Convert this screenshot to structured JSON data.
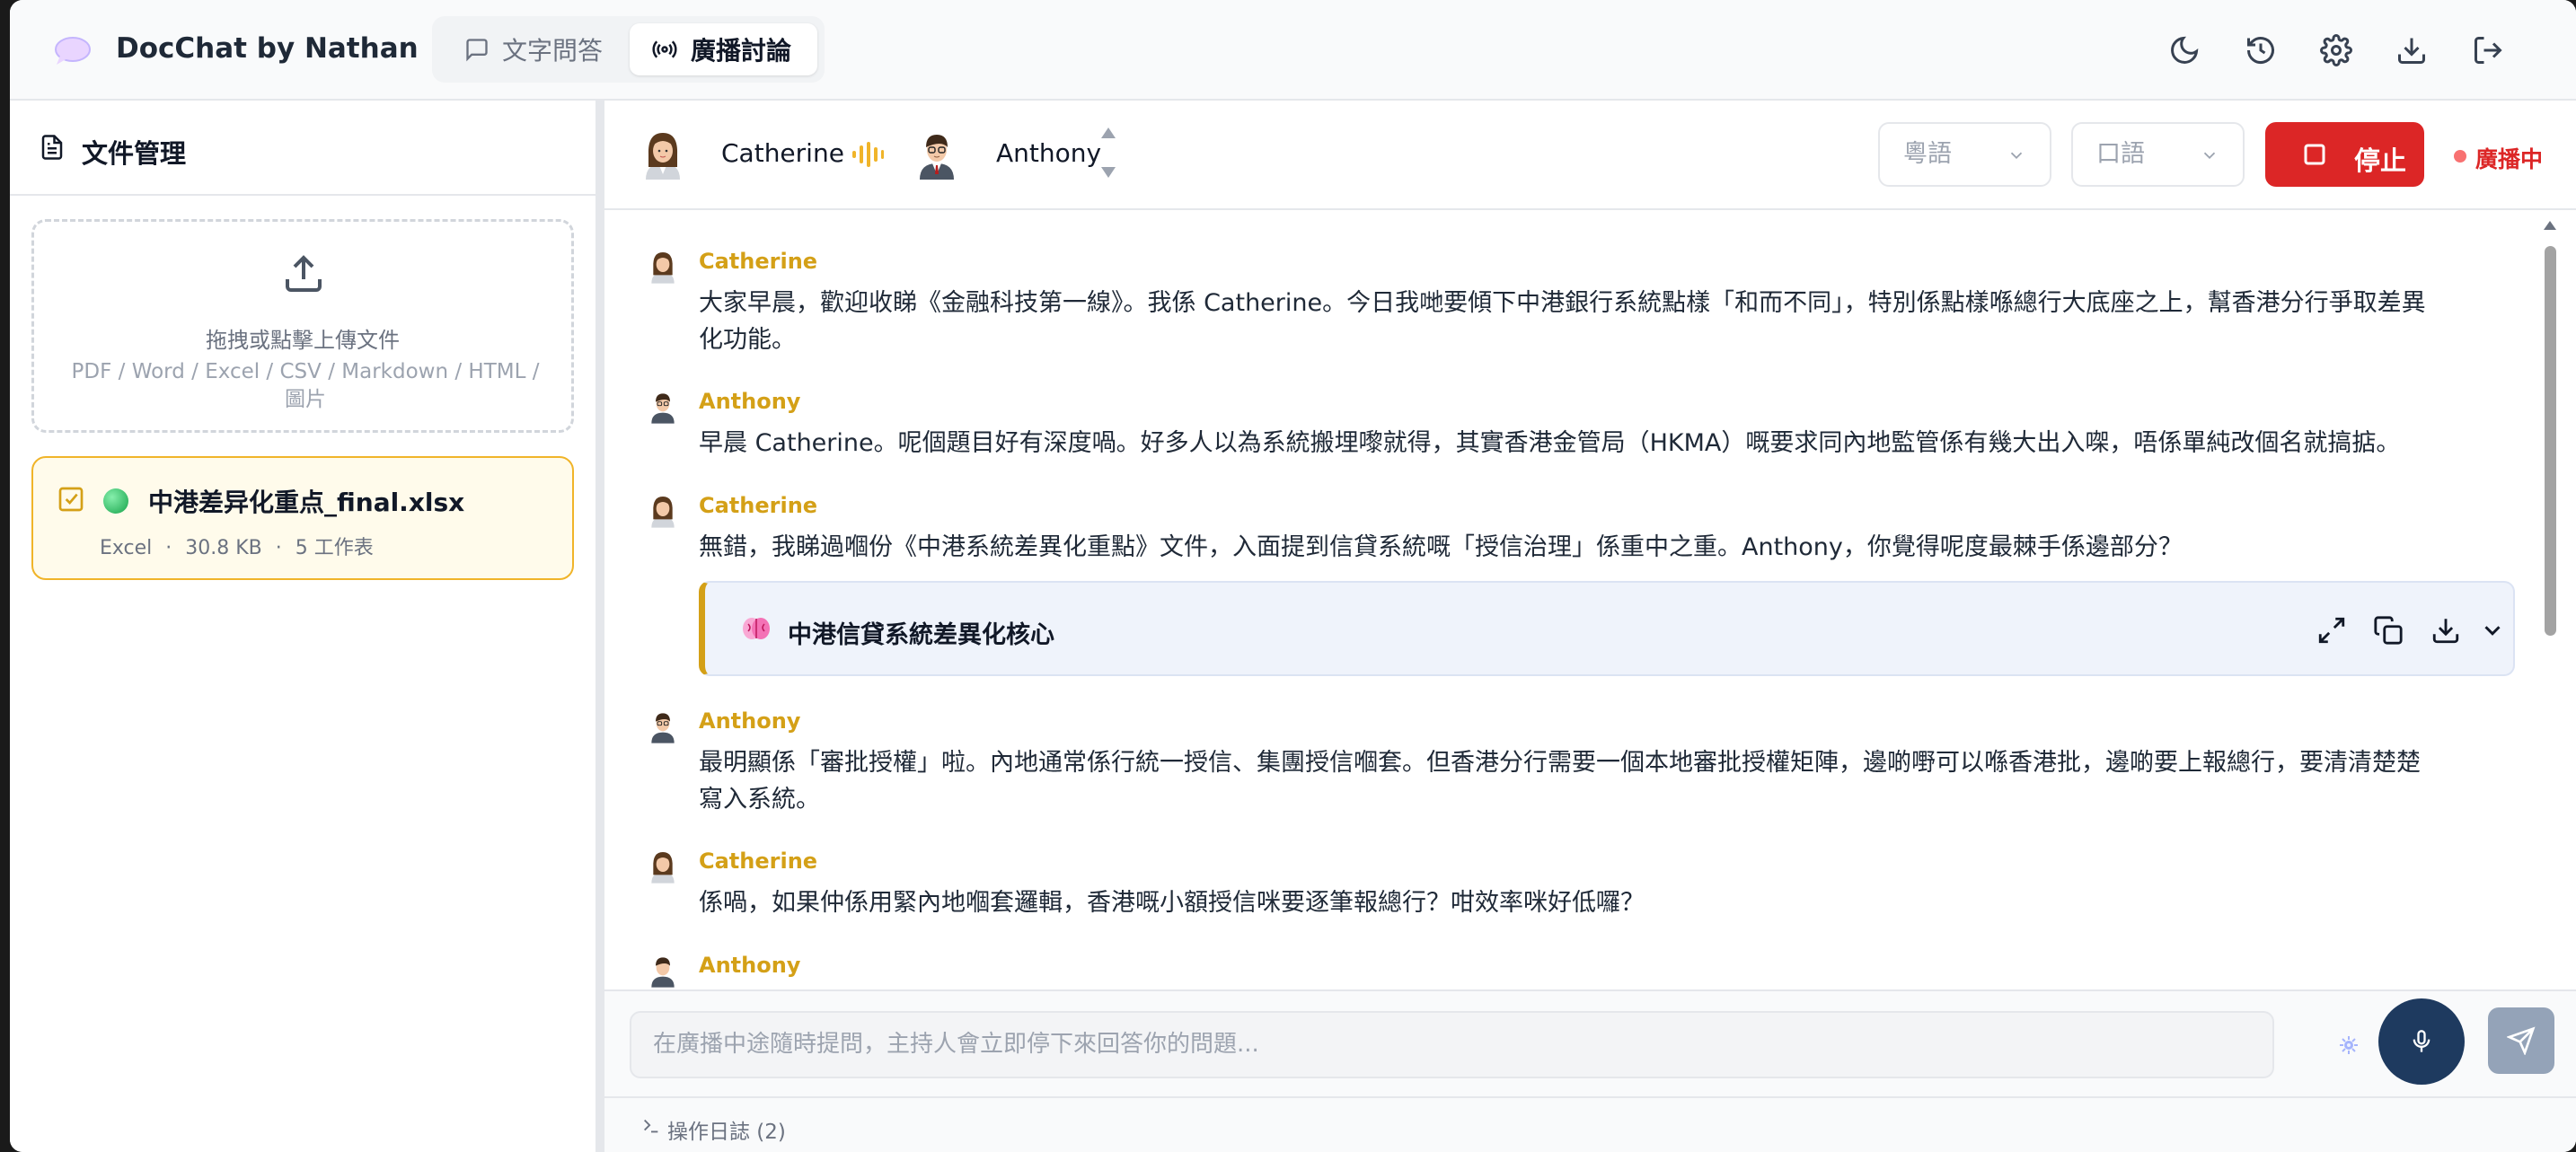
{
  "app": {
    "title": "DocChat by Nathan"
  },
  "tabs": [
    {
      "label": "文字問答",
      "icon": "chat-bubble-icon"
    },
    {
      "label": "廣播討論",
      "icon": "broadcast-icon"
    }
  ],
  "header_actions": [
    "moon-icon",
    "history-icon",
    "gear-icon",
    "download-icon",
    "logout-icon"
  ],
  "sidebar": {
    "title": "文件管理",
    "upload": {
      "primary": "拖拽或點擊上傳文件",
      "formats": "PDF / Word / Excel / CSV / Markdown / HTML / 圖片"
    },
    "file": {
      "name": "中港差异化重点_final.xlsx",
      "type": "Excel",
      "size": "30.8 KB",
      "sheets": "5 工作表",
      "sep": "·"
    }
  },
  "broadcast": {
    "hosts": [
      {
        "name": "Catherine"
      },
      {
        "name": "Anthony"
      }
    ],
    "language": "粵語",
    "style": "口語",
    "stop_label": "停止",
    "status": "廣播中"
  },
  "messages": [
    {
      "speaker": "Catherine",
      "text": "大家早晨，歡迎收睇《金融科技第一線》。我係 Catherine。今日我哋要傾下中港銀行系統點樣「和而不同」，特別係點樣喺總行大底座之上，幫香港分行爭取差異化功能。"
    },
    {
      "speaker": "Anthony",
      "text": "早晨 Catherine。呢個題目好有深度喎。好多人以為系統搬埋嚟就得，其實香港金管局（HKMA）嘅要求同內地監管係有幾大出入㗎，唔係單純改個名就搞掂。"
    },
    {
      "speaker": "Catherine",
      "text": "無錯，我睇過嗰份《中港系統差異化重點》文件，入面提到信貸系統嘅「授信治理」係重中之重。Anthony，你覺得呢度最棘手係邊部分？"
    },
    {
      "speaker": "Anthony",
      "text": "最明顯係「審批授權」啦。內地通常係行統一授信、集團授信嗰套。但香港分行需要一個本地審批授權矩陣，邊啲嘢可以喺香港批，邊啲要上報總行，要清清楚楚寫入系統。"
    },
    {
      "speaker": "Catherine",
      "text": "係喎，如果仲係用緊內地嗰套邏輯，香港嘅小額授信咪要逐筆報總行？咁效率咪好低囉？"
    },
    {
      "speaker": "Anthony",
      "text": ""
    }
  ],
  "mindmap": {
    "title": "中港信貸系統差異化核心"
  },
  "input": {
    "placeholder": "在廣播中途隨時提問，主持人會立即停下來回答你的問題..."
  },
  "log": {
    "label": "操作日誌 (2)"
  }
}
